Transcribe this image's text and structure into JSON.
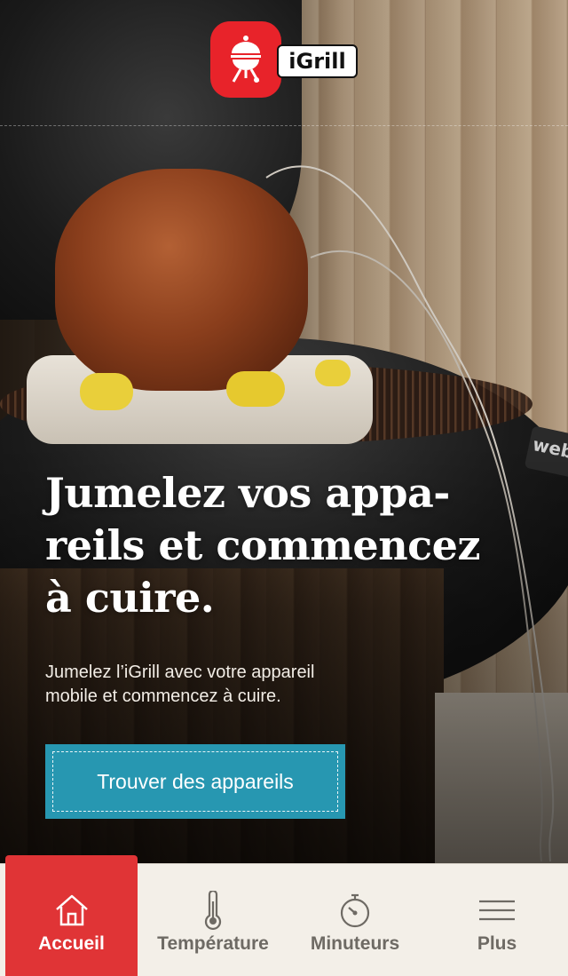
{
  "app": {
    "logo_text": "iGrill",
    "brand_color": "#e8232a"
  },
  "hero": {
    "headline_lines": [
      "Jumelez vos appa-",
      "reils et commencez",
      "à cuire."
    ],
    "subtext_lines": [
      "Jumelez l’iGrill avec votre appareil",
      "mobile et commencez à cuire."
    ],
    "cta_label": "Trouver des appareils",
    "cta_color": "#2797b1",
    "background_brand_text": "weber"
  },
  "tabbar": {
    "active_color": "#e03436",
    "tabs": [
      {
        "label": "Accueil",
        "icon": "home-icon",
        "active": true
      },
      {
        "label": "Température",
        "icon": "thermometer-icon",
        "active": false
      },
      {
        "label": "Minuteurs",
        "icon": "stopwatch-icon",
        "active": false
      },
      {
        "label": "Plus",
        "icon": "menu-icon",
        "active": false
      }
    ]
  }
}
